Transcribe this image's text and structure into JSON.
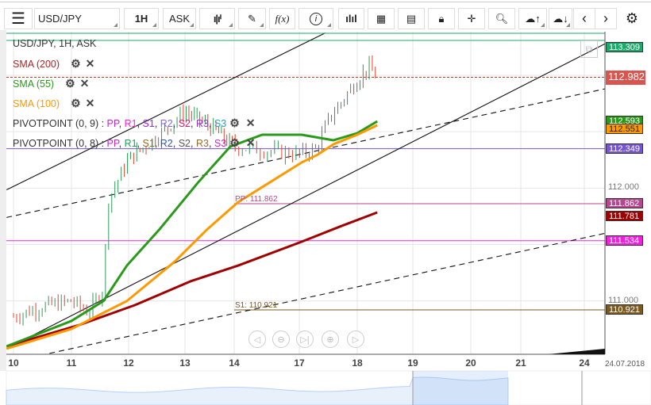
{
  "toolbar": {
    "symbol": "USD/JPY",
    "timeframe": "1H",
    "price_type": "ASK",
    "fx_label": "f(x)",
    "icons": [
      "menu-icon",
      "candlestick-icon",
      "pencil-icon",
      "function-icon",
      "info-icon",
      "bar-chart-icon",
      "calendar-icon",
      "news-icon",
      "lock-icon",
      "crosshair-icon",
      "zoom-chart-icon",
      "upload-cloud-icon",
      "download-cloud-icon",
      "chevron-left-icon",
      "chevron-right-icon",
      "gear-icon"
    ]
  },
  "legend": {
    "title": "USD/JPY, 1H, ASK",
    "sma200": "SMA (200)",
    "sma55": "SMA (55)",
    "sma100": "SMA (100)",
    "pivot9": {
      "name": "PIVOTPOINT (0, 9)",
      "sep": " : ",
      "items": [
        "PP",
        "R1",
        "S1",
        "R2",
        "S2",
        "R3",
        "S3"
      ],
      "colors": [
        "#c026d3",
        "#ff22cc",
        "#a020f0",
        "#7b68ee",
        "#cc2277",
        "#9932cc",
        "#1ea0c8"
      ]
    },
    "pivot8": {
      "name": "PIVOTPOINT (0, 8)",
      "sep": " : ",
      "items": [
        "PP",
        "R1",
        "S1",
        "R2",
        "S2",
        "R3",
        "S3"
      ],
      "colors": [
        "#c026d3",
        "#20a060",
        "#8b6914",
        "#3050b0",
        "#555555",
        "#9b6a2a",
        "#c026d3"
      ]
    }
  },
  "chart_data": {
    "type": "candlestick",
    "x_tick_labels": [
      "10",
      "11",
      "12",
      "13",
      "14",
      "17",
      "18",
      "19",
      "20",
      "21",
      "24"
    ],
    "date_label": "24.07.2018",
    "y_tick_labels": [
      "112.000",
      "111.000"
    ],
    "y_ticks": [
      112.0,
      111.0
    ],
    "price_path": [
      [
        0,
        110.86
      ],
      [
        0.5,
        110.95
      ],
      [
        1,
        111.0
      ],
      [
        1.3,
        110.9
      ],
      [
        1.55,
        111.1
      ],
      [
        1.65,
        111.9
      ],
      [
        2,
        112.26
      ],
      [
        2.5,
        112.45
      ],
      [
        3,
        112.68
      ],
      [
        3.5,
        112.55
      ],
      [
        4,
        112.37
      ],
      [
        4.5,
        112.33
      ],
      [
        5,
        112.3
      ],
      [
        5.3,
        112.35
      ],
      [
        5.5,
        112.6
      ],
      [
        6,
        112.96
      ],
      [
        6.2,
        113.07
      ],
      [
        6.36,
        112.98
      ]
    ],
    "sma": [
      {
        "name": "SMA (200)",
        "color": "#a00000",
        "points": [
          [
            -0.12,
            110.598
          ],
          [
            1.14,
            110.788
          ],
          [
            2.11,
            110.963
          ],
          [
            3.11,
            111.174
          ],
          [
            4.06,
            111.314
          ],
          [
            5.04,
            111.525
          ],
          [
            5.73,
            111.665
          ],
          [
            6.36,
            111.785
          ]
        ]
      },
      {
        "name": "SMA (55)",
        "color": "#2a9a1a",
        "points": [
          [
            -0.12,
            110.598
          ],
          [
            1,
            110.823
          ],
          [
            1.56,
            111.0
          ],
          [
            1.97,
            111.314
          ],
          [
            2.54,
            111.63
          ],
          [
            3.27,
            112.052
          ],
          [
            3.92,
            112.368
          ],
          [
            4.43,
            112.473
          ],
          [
            5.04,
            112.473
          ],
          [
            5.59,
            112.424
          ],
          [
            6,
            112.487
          ],
          [
            6.36,
            112.592
          ]
        ]
      },
      {
        "name": "SMA (100)",
        "color": "#ff9900",
        "points": [
          [
            -0.12,
            110.577
          ],
          [
            1,
            110.752
          ],
          [
            1.97,
            111.0
          ],
          [
            2.82,
            111.35
          ],
          [
            3.44,
            111.63
          ],
          [
            4.06,
            111.876
          ],
          [
            4.55,
            112.052
          ],
          [
            5.04,
            112.227
          ],
          [
            5.32,
            112.297
          ],
          [
            5.59,
            112.389
          ],
          [
            6,
            112.473
          ],
          [
            6.36,
            112.557
          ]
        ]
      }
    ],
    "trendlines": [
      {
        "style": "solid",
        "from": [
          -0.12,
          111.985
        ],
        "to": [
          5.45,
          113.375
        ]
      },
      {
        "style": "solid",
        "from": [
          -0.12,
          110.577
        ],
        "to": [
          10.33,
          113.28
        ]
      },
      {
        "style": "dashed",
        "from": [
          -0.12,
          111.74
        ],
        "to": [
          10.33,
          112.88
        ]
      },
      {
        "style": "dashed",
        "from": [
          0.3,
          110.5
        ],
        "to": [
          10.33,
          111.6
        ]
      }
    ],
    "levels": [
      {
        "value": 113.309,
        "label": "113.309",
        "color": "#1aaa6a"
      },
      {
        "value": 112.349,
        "label": "112.349",
        "color": "#7755cc"
      },
      {
        "value": 111.862,
        "label": "111.862",
        "color": "#b5478f",
        "text": "PP: 111.862"
      },
      {
        "value": 111.534,
        "label": "111.534",
        "color": "#ee22dd"
      },
      {
        "value": 110.921,
        "label": "110.921",
        "color": "#7a5a20",
        "text": "S1: 110.921"
      }
    ],
    "current_price": {
      "value": 112.982,
      "label": "112.982",
      "color": "#d9534f"
    },
    "sma_labels": [
      {
        "label": "112.593",
        "color": "#2a9a1a"
      },
      {
        "label": "112.551",
        "color": "#ff9900"
      },
      {
        "label": "111.781",
        "color": "#a00000"
      }
    ]
  },
  "controls": [
    "scroll-left",
    "zoom-out",
    "reset",
    "zoom-in",
    "scroll-right"
  ]
}
